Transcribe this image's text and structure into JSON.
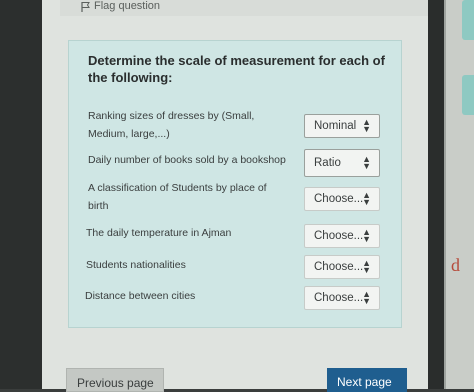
{
  "header": {
    "flag_label": "Flag question"
  },
  "question": {
    "text": "Determine the scale of measurement for each of the following:"
  },
  "rows": [
    {
      "label": "Ranking sizes of dresses by (Small, Medium, large,...)",
      "selected": "Nominal"
    },
    {
      "label": "Daily number of books sold by a bookshop",
      "selected": "Ratio"
    },
    {
      "label": "A classification of Students by place of birth",
      "selected": "Choose..."
    },
    {
      "label": "The daily temperature in Ajman",
      "selected": "Choose..."
    },
    {
      "label": "Students nationalities",
      "selected": "Choose..."
    },
    {
      "label": "Distance between cities",
      "selected": "Choose..."
    }
  ],
  "navigation": {
    "previous_label": "Previous page",
    "next_label": "Next page"
  },
  "side_panel": {
    "partial_text": "d"
  },
  "colors": {
    "card_bg": "#cfe6e4",
    "next_button": "#1f5e8f",
    "accent_tab": "#8ec9c2"
  }
}
